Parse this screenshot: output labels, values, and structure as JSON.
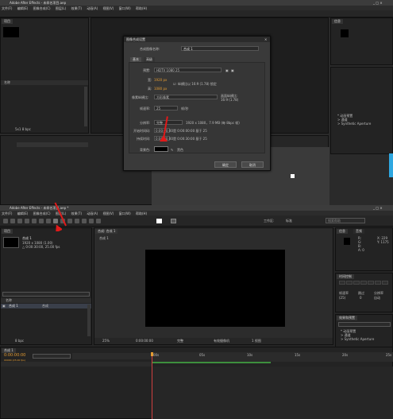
{
  "top": {
    "window_title": "Adobe After Effects - 未命名项目.aep",
    "menu": [
      "文件(F)",
      "编辑(E)",
      "图像合成(C)",
      "图层(L)",
      "效果(T)",
      "动画(A)",
      "视图(V)",
      "窗口(W)",
      "帮助(H)"
    ],
    "dialog": {
      "title": "图像合成设置",
      "name_label": "合成图像名称:",
      "name_value": "合成 1",
      "tabs": [
        "基本",
        "高级"
      ],
      "preset_label": "预置:",
      "preset_value": "HDTV 1080 25",
      "width_label": "宽:",
      "width_value": "1920 px",
      "height_label": "高:",
      "height_value": "1080 px",
      "lock_ratio": "纵横比以 16:9 (1.78) 锁定",
      "pixel_aspect_label": "像素纵横比:",
      "pixel_aspect_value": "方形像素",
      "frame_aspect_label": "画面纵横比:",
      "frame_aspect_value": "16:9 (1.78)",
      "frame_rate_label": "帧速率:",
      "frame_rate_value": "25",
      "frame_rate_unit": "帧/秒",
      "resolution_label": "分辨率:",
      "resolution_value": "完整",
      "resolution_info": "1920 x 1080，7.9 MB (每 8bpc 帧)",
      "start_tc_label": "开始时间码:",
      "start_tc_value": "0:00:00:00",
      "start_tc_base": "是 0:00:00:00 基于 25",
      "duration_label": "持续时间:",
      "duration_value": "0:00:30:00",
      "duration_base": "是 0:00:30:00 基于 25",
      "bg_label": "背景色:",
      "bg_name": "黑色",
      "ok": "确定",
      "cancel": "取消"
    },
    "left_panel_tab": "项目",
    "left_panel_header": "名称",
    "right_panel_tab": "信息",
    "effects_items": [
      "* 动画预置",
      "> 通道",
      "> Synthetic Aperture"
    ],
    "resolution_zoom": "5x1  8 bpc"
  },
  "bottom": {
    "window_title": "Adobe After Effects - 未命名项目.aep *",
    "menu": [
      "文件(F)",
      "编辑(E)",
      "图像合成(C)",
      "图层(L)",
      "效果(T)",
      "动画(A)",
      "视图(V)",
      "窗口(W)",
      "帮助(H)"
    ],
    "workspace_label": "工作区:",
    "workspace_value": "标准",
    "search_hint": "搜索帮助",
    "project": {
      "tab": "项目",
      "comp_name": "合成 1",
      "comp_info_1": "1920 x 1080 (1.00)",
      "comp_info_2": "△ 0:00:30:00, 25.00 fps",
      "col_name": "名称",
      "item_name": "合成 1",
      "item_type": "合成",
      "bpc": "8 bpc"
    },
    "comp_viewer": {
      "tab": "合成: 合成 1",
      "breadcrumb": "合成 1",
      "zoom": "25%",
      "timecode": "0:00:00:00",
      "quality": "完整",
      "camera": "有效摄像机",
      "view": "1 视图"
    },
    "info_panel": {
      "tab1": "信息",
      "tab2": "音频",
      "r": "R:",
      "g": "G:",
      "b": "B:",
      "a": "A: 0",
      "x": "X: 229",
      "y": "Y: 1175"
    },
    "preview_panel": {
      "tab": "时间控制",
      "frame_rate_label": "帧速率",
      "skip_label": "跳过",
      "resolution_label": "分辨率",
      "frame_rate_value": "(25)",
      "skip_value": "0",
      "resolution_value": "自动"
    },
    "effects_panel": {
      "tab": "效果和预置",
      "items": [
        "* 动画预置",
        "> 通道",
        "> Synthetic Aperture"
      ]
    },
    "timeline": {
      "tab": "合成 1",
      "timecode": "0:00:00:00",
      "frame_info": "00000 (25.00 fps)",
      "ruler_marks": [
        "00s",
        "05s",
        "10s",
        "15s",
        "20s",
        "25s"
      ]
    }
  }
}
